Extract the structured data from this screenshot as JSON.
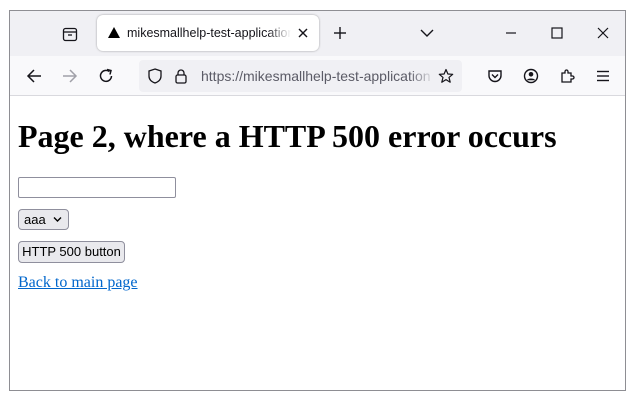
{
  "browser": {
    "tab": {
      "title": "mikesmallhelp-test-application",
      "favicon": "triangle-icon"
    },
    "toolbar": {
      "url": "https://mikesmallhelp-test-application",
      "icons": [
        "back-arrow-icon",
        "forward-arrow-icon",
        "reload-icon",
        "shield-icon",
        "lock-icon",
        "bookmark-star-icon",
        "pocket-icon",
        "account-icon",
        "extensions-icon",
        "menu-icon"
      ]
    },
    "window_controls": [
      "minimize-icon",
      "maximize-icon",
      "close-icon"
    ]
  },
  "page": {
    "heading": "Page 2, where a HTTP 500 error occurs",
    "text_input": {
      "value": ""
    },
    "select": {
      "selected": "aaa"
    },
    "button": {
      "label": "HTTP 500 button"
    },
    "link": {
      "label": "Back to main page"
    }
  },
  "colors": {
    "tabbar_bg": "#f0f0f4",
    "navbar_bg": "#f9f9fb",
    "link": "#0066cc"
  }
}
